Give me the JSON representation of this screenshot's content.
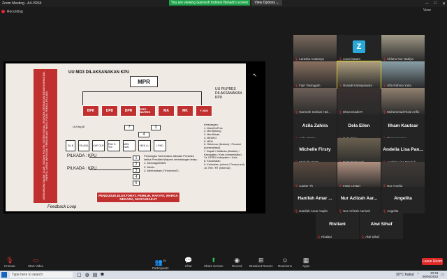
{
  "window": {
    "title": "Zoom Meeting - A4-VR64",
    "viewing_banner": "You are viewing Garnesh Indriani Bahadi's screen",
    "view_options": "View Options ⌄",
    "recording": "Recording",
    "view_label": "View"
  },
  "slide": {
    "left_vertical": "LINGKUNGAN DALAM / LUAR : BUDAYA POLITIK, SISTEM SOSIAL, EKONOMI, ORGANISASI KEMASYARAKATAN, PARPOL, MEDIA (INFOKOM), PERGURUAN TINGGI, POLRI, PEMILU, PILKADA",
    "uu_md3": "UU MD3 DILAKSANAKAN KPU",
    "mpr": "MPR",
    "bodies": [
      "BPK",
      "DPD",
      "DPR",
      "PRES WAPRES",
      "MA",
      "MK",
      "Y UDIS"
    ],
    "uu_pilpres": "UU PILPRES DILAKSANAKAN KPU",
    "uu_tbg": "UU tbg Bi",
    "box_numbers": [
      "7",
      "3",
      "4"
    ],
    "ministries": [
      "GU B",
      "EN ADA",
      "KAP OLR",
      "PAN G TNI",
      "MEN HAN",
      "MEN LU",
      "LPND"
    ],
    "pilkada_kpu_1": "PILKADA : KPU",
    "pilkada_kpu_2": "PILKADA : KPU",
    "row_numbers": [
      "1",
      "2",
      "3",
      "4",
      "5"
    ],
    "legend_title": "Keterangan:",
    "legend_items": [
      "1. WamHmPres",
      "2. MenSekneg",
      "3. MenSekab",
      "4. MENKO",
      "5. MEN",
      "6. Gubernur (titulatur) / Provinsi (nomenklatur)",
      "7. Bupati / Walikota (titulatur) / Kabupaten / Kota (nomenklatur)",
      "7a. DPRD Kabupaten / Kota",
      "8. Kecamatan",
      "9. Kelurahan (urban) / Desa (rural)",
      "10. RW / RT (informal)"
    ],
    "pemangku_title": "Pemangku Sementara Jabatan Presiden ketika Presiden/Wapres berhalangan tetap:",
    "pemangku_items": [
      "1. Mendagri/MDN",
      "2. Menlu",
      "3. Menhankam (\"triumvirat\")"
    ],
    "people_box": "PENDUDUK,ELEKTORAT, PEMILIH, RAKYAT, WARGA NEGARA, MASYARAKAT",
    "feedback": "Feedback Loop"
  },
  "participants": [
    {
      "name": "Larasita Anatasya",
      "kind": "video"
    },
    {
      "name": "zoom baa04",
      "kind": "avatar",
      "letter": "Z"
    },
    {
      "name": "Ahlanu Nur Nadiya",
      "kind": "video"
    },
    {
      "name": "Fajri Tasinggah",
      "kind": "video"
    },
    {
      "name": "Rusadi Kantaprawira",
      "kind": "video"
    },
    {
      "name": "Ulfa Rahma Yulia",
      "kind": "video"
    },
    {
      "name": "Garnesh Indriani Hal...",
      "kind": "video"
    },
    {
      "name": "Dhea Diadti R",
      "kind": "video"
    },
    {
      "name": "Muhammad Rizal Arifin",
      "kind": "video"
    },
    {
      "name": "Azila Zahira",
      "kind": "name"
    },
    {
      "name": "Dela Eilen",
      "kind": "name"
    },
    {
      "name": "Ilham Kautsar",
      "kind": "name"
    },
    {
      "name": "Michelle Firsty",
      "kind": "name"
    },
    {
      "name": "Evita Febryanti",
      "kind": "video"
    },
    {
      "name": "Andelia Lisa Pan...",
      "full": "Andelia Lisa Pandeli",
      "kind": "name"
    },
    {
      "name": "Jupiter Th",
      "kind": "video"
    },
    {
      "name": "Intan Lestari",
      "kind": "video"
    },
    {
      "name": "Nur Amelia",
      "kind": "video"
    },
    {
      "name": "Hanifah Amar ...",
      "full": "Hanifah Amar Aaqila",
      "kind": "name"
    },
    {
      "name": "Nur Azlizah Aar...",
      "full": "Nur Azlizah Aarisah",
      "kind": "name"
    },
    {
      "name": "Angelita",
      "kind": "name"
    },
    {
      "name": "Ristiani",
      "kind": "name"
    },
    {
      "name": "Alwi Sihaf",
      "kind": "name"
    }
  ],
  "toolbar": {
    "unmute": "Unmute",
    "start_video": "Start Video",
    "participants": "Participants",
    "participants_count": "25",
    "chat": "Chat",
    "share_screen": "Share Screen",
    "record": "Record",
    "breakout": "Breakout Rooms",
    "reactions": "Reactions",
    "apps": "Apps",
    "leave": "Leave Room"
  },
  "taskbar": {
    "search": "Type here to search",
    "weather": "30°C Kabut",
    "time": "10:34",
    "date": "06/04/2022"
  }
}
